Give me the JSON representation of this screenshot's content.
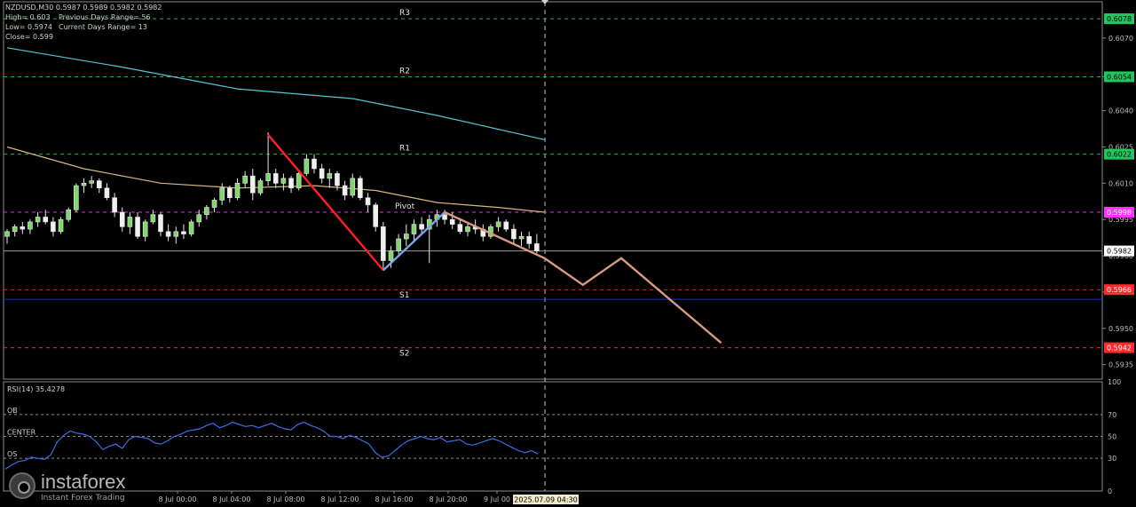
{
  "header": {
    "symbol_line": "NZDUSD,M30  0.5987 0.5989 0.5982 0.5982",
    "high": "High= 0.603",
    "low": "Low= 0.5974",
    "close": "Close= 0.599",
    "prev_range": "Previous Days Range= 56",
    "curr_range": "Current Days Range= 13"
  },
  "brand": {
    "name": "instaforex",
    "tagline": "Instant Forex Trading"
  },
  "colors": {
    "resistance": "#22c55e",
    "pivot": "#ff33ff",
    "support": "#ff2a2a",
    "support_blue": "#2a2aff",
    "ma_fast": "#d8b878",
    "ma_slow": "#55c8d8",
    "down_wave": "#ff2020",
    "up_wave": "#7aa6e6",
    "projection": "#d99a7f",
    "rsi": "#3a6ee8"
  },
  "chart_data": {
    "type": "candlestick",
    "symbol": "NZDUSD",
    "timeframe": "M30",
    "ylim": [
      0.5929,
      0.6085
    ],
    "price_ticks": [
      0.607,
      0.6054,
      0.604,
      0.6025,
      0.601,
      0.5995,
      0.598,
      0.5965,
      0.595,
      0.5935
    ],
    "time_labels": [
      "8 Jul 00:00",
      "8 Jul 04:00",
      "8 Jul 08:00",
      "8 Jul 12:00",
      "8 Jul 16:00",
      "8 Jul 20:00",
      "9 Jul 00"
    ],
    "current_time_label": "2025.07.09 04:30",
    "levels": [
      {
        "name": "R3",
        "price": 0.6078,
        "label": "0.6078",
        "kind": "resistance"
      },
      {
        "name": "R2",
        "price": 0.6054,
        "label": "0.6054",
        "kind": "resistance"
      },
      {
        "name": "R1",
        "price": 0.6022,
        "label": "0.6022",
        "kind": "resistance"
      },
      {
        "name": "Pivot",
        "price": 0.5998,
        "label": "0.5998",
        "kind": "pivot"
      },
      {
        "name": "S1",
        "price": 0.5966,
        "label": "0.5966",
        "kind": "support"
      },
      {
        "name": "",
        "price": 0.5962,
        "label": "",
        "kind": "support_blue"
      },
      {
        "name": "S2",
        "price": 0.5942,
        "label": "0.5942",
        "kind": "support"
      }
    ],
    "current_price": {
      "price": 0.5982,
      "label": "0.5982"
    },
    "candles": [
      [
        0,
        0.5988,
        0.5991,
        0.5985,
        0.599
      ],
      [
        1,
        0.599,
        0.5993,
        0.5988,
        0.5992
      ],
      [
        2,
        0.5992,
        0.5994,
        0.5989,
        0.5991
      ],
      [
        3,
        0.5991,
        0.5995,
        0.5989,
        0.5994
      ],
      [
        4,
        0.5994,
        0.5998,
        0.5992,
        0.5996
      ],
      [
        5,
        0.5996,
        0.5999,
        0.5993,
        0.5994
      ],
      [
        6,
        0.5994,
        0.5996,
        0.5988,
        0.599
      ],
      [
        7,
        0.599,
        0.5996,
        0.5989,
        0.5995
      ],
      [
        8,
        0.5995,
        0.6,
        0.5994,
        0.5999
      ],
      [
        9,
        0.5999,
        0.601,
        0.5998,
        0.6009
      ],
      [
        10,
        0.6009,
        0.6012,
        0.6006,
        0.601
      ],
      [
        11,
        0.601,
        0.6013,
        0.6008,
        0.6011
      ],
      [
        12,
        0.6011,
        0.6012,
        0.6006,
        0.6008
      ],
      [
        13,
        0.6008,
        0.601,
        0.6003,
        0.6004
      ],
      [
        14,
        0.6004,
        0.6006,
        0.5996,
        0.5998
      ],
      [
        15,
        0.5998,
        0.6,
        0.599,
        0.5992
      ],
      [
        16,
        0.5992,
        0.5998,
        0.5989,
        0.5996
      ],
      [
        17,
        0.5996,
        0.5998,
        0.5987,
        0.5988
      ],
      [
        18,
        0.5988,
        0.5995,
        0.5986,
        0.5994
      ],
      [
        19,
        0.5994,
        0.5999,
        0.5993,
        0.5997
      ],
      [
        20,
        0.5997,
        0.5998,
        0.5988,
        0.599
      ],
      [
        21,
        0.599,
        0.5993,
        0.5986,
        0.5988
      ],
      [
        22,
        0.5988,
        0.5992,
        0.5985,
        0.599
      ],
      [
        23,
        0.599,
        0.5993,
        0.5987,
        0.5989
      ],
      [
        24,
        0.5989,
        0.5995,
        0.5988,
        0.5994
      ],
      [
        25,
        0.5994,
        0.5999,
        0.5992,
        0.5997
      ],
      [
        26,
        0.5997,
        0.6001,
        0.5995,
        0.6
      ],
      [
        27,
        0.6,
        0.6004,
        0.5998,
        0.6003
      ],
      [
        28,
        0.6003,
        0.601,
        0.6001,
        0.6008
      ],
      [
        29,
        0.6008,
        0.6009,
        0.6002,
        0.6004
      ],
      [
        30,
        0.6004,
        0.6012,
        0.6003,
        0.601
      ],
      [
        31,
        0.601,
        0.6015,
        0.6008,
        0.6013
      ],
      [
        32,
        0.6013,
        0.6016,
        0.6003,
        0.6006
      ],
      [
        33,
        0.6006,
        0.6012,
        0.6005,
        0.6011
      ],
      [
        34,
        0.6011,
        0.6031,
        0.6009,
        0.6014
      ],
      [
        35,
        0.6014,
        0.6016,
        0.6008,
        0.601
      ],
      [
        36,
        0.601,
        0.6014,
        0.6007,
        0.6012
      ],
      [
        37,
        0.6012,
        0.6013,
        0.6006,
        0.6008
      ],
      [
        38,
        0.6008,
        0.6015,
        0.6007,
        0.6014
      ],
      [
        39,
        0.6014,
        0.6022,
        0.6013,
        0.602
      ],
      [
        40,
        0.602,
        0.6022,
        0.6014,
        0.6016
      ],
      [
        41,
        0.6016,
        0.6018,
        0.601,
        0.6012
      ],
      [
        42,
        0.6012,
        0.6016,
        0.6008,
        0.6014
      ],
      [
        43,
        0.6014,
        0.6015,
        0.6007,
        0.6009
      ],
      [
        44,
        0.6009,
        0.6011,
        0.6003,
        0.6005
      ],
      [
        45,
        0.6005,
        0.6014,
        0.6004,
        0.6012
      ],
      [
        46,
        0.6012,
        0.6013,
        0.6003,
        0.6004
      ],
      [
        47,
        0.6004,
        0.6006,
        0.5998,
        0.6001
      ],
      [
        48,
        0.6001,
        0.6002,
        0.599,
        0.5992
      ],
      [
        49,
        0.5992,
        0.5994,
        0.5974,
        0.5978
      ],
      [
        50,
        0.5978,
        0.5984,
        0.5975,
        0.5982
      ],
      [
        51,
        0.5982,
        0.5989,
        0.598,
        0.5987
      ],
      [
        52,
        0.5987,
        0.5993,
        0.5984,
        0.5989
      ],
      [
        53,
        0.5989,
        0.5995,
        0.5986,
        0.5993
      ],
      [
        54,
        0.5993,
        0.5996,
        0.5989,
        0.5991
      ],
      [
        55,
        0.5991,
        0.5997,
        0.5977,
        0.5995
      ],
      [
        56,
        0.5995,
        0.5999,
        0.5992,
        0.5997
      ],
      [
        57,
        0.5997,
        0.5999,
        0.5993,
        0.5995
      ],
      [
        58,
        0.5995,
        0.5998,
        0.5991,
        0.5993
      ],
      [
        59,
        0.5993,
        0.5995,
        0.5989,
        0.599
      ],
      [
        60,
        0.599,
        0.5994,
        0.5988,
        0.5992
      ],
      [
        61,
        0.5992,
        0.5995,
        0.5989,
        0.5991
      ],
      [
        62,
        0.5991,
        0.5993,
        0.5986,
        0.5988
      ],
      [
        63,
        0.5988,
        0.5993,
        0.5987,
        0.5992
      ],
      [
        64,
        0.5992,
        0.5996,
        0.599,
        0.5994
      ],
      [
        65,
        0.5994,
        0.5995,
        0.599,
        0.5991
      ],
      [
        66,
        0.5991,
        0.5993,
        0.5985,
        0.5987
      ],
      [
        67,
        0.5987,
        0.599,
        0.5984,
        0.5988
      ],
      [
        68,
        0.5988,
        0.599,
        0.5983,
        0.5985
      ],
      [
        69,
        0.5985,
        0.5989,
        0.5981,
        0.5982
      ]
    ],
    "ma_fast": [
      [
        0,
        0.6025
      ],
      [
        10,
        0.6016
      ],
      [
        20,
        0.601
      ],
      [
        30,
        0.6008
      ],
      [
        40,
        0.6009
      ],
      [
        48,
        0.6007
      ],
      [
        56,
        0.6002
      ],
      [
        64,
        0.6
      ],
      [
        70,
        0.5998
      ]
    ],
    "ma_slow": [
      [
        0,
        0.6066
      ],
      [
        15,
        0.6058
      ],
      [
        30,
        0.6049
      ],
      [
        45,
        0.6045
      ],
      [
        56,
        0.6038
      ],
      [
        70,
        0.6028
      ]
    ],
    "waves": [
      {
        "name": "down",
        "points": [
          [
            34,
            0.603
          ],
          [
            49,
            0.5974
          ]
        ],
        "color_key": "down_wave"
      },
      {
        "name": "up",
        "points": [
          [
            49,
            0.5974
          ],
          [
            57,
            0.5998
          ]
        ],
        "color_key": "up_wave"
      },
      {
        "name": "projection",
        "points": [
          [
            57,
            0.5998
          ],
          [
            70,
            0.5979
          ],
          [
            75,
            0.5968
          ],
          [
            80,
            0.5979
          ],
          [
            93,
            0.5944
          ]
        ],
        "color_key": "projection"
      }
    ],
    "rsi": {
      "label": "RSI(14) 35.4278",
      "ylim": [
        0,
        100
      ],
      "ticks": [
        100,
        70,
        50,
        30,
        0
      ],
      "zones": [
        {
          "name": "OB",
          "value": 70
        },
        {
          "name": "CENTER",
          "value": 50
        },
        {
          "name": "OS",
          "value": 30
        }
      ],
      "values": [
        20,
        24,
        27,
        28,
        31,
        30,
        29,
        33,
        45,
        51,
        55,
        53,
        52,
        50,
        45,
        38,
        41,
        43,
        39,
        47,
        50,
        49,
        48,
        44,
        43,
        46,
        50,
        52,
        55,
        56,
        57,
        60,
        62,
        58,
        60,
        63,
        61,
        59,
        60,
        58,
        60,
        62,
        59,
        57,
        56,
        61,
        63,
        60,
        58,
        55,
        50,
        50,
        48,
        51,
        49,
        46,
        43,
        35,
        31,
        32,
        37,
        42,
        46,
        48,
        50,
        48,
        47,
        49,
        45,
        46,
        47,
        43,
        42,
        44,
        46,
        48,
        46,
        43,
        40,
        37,
        35,
        37,
        34
      ]
    }
  }
}
